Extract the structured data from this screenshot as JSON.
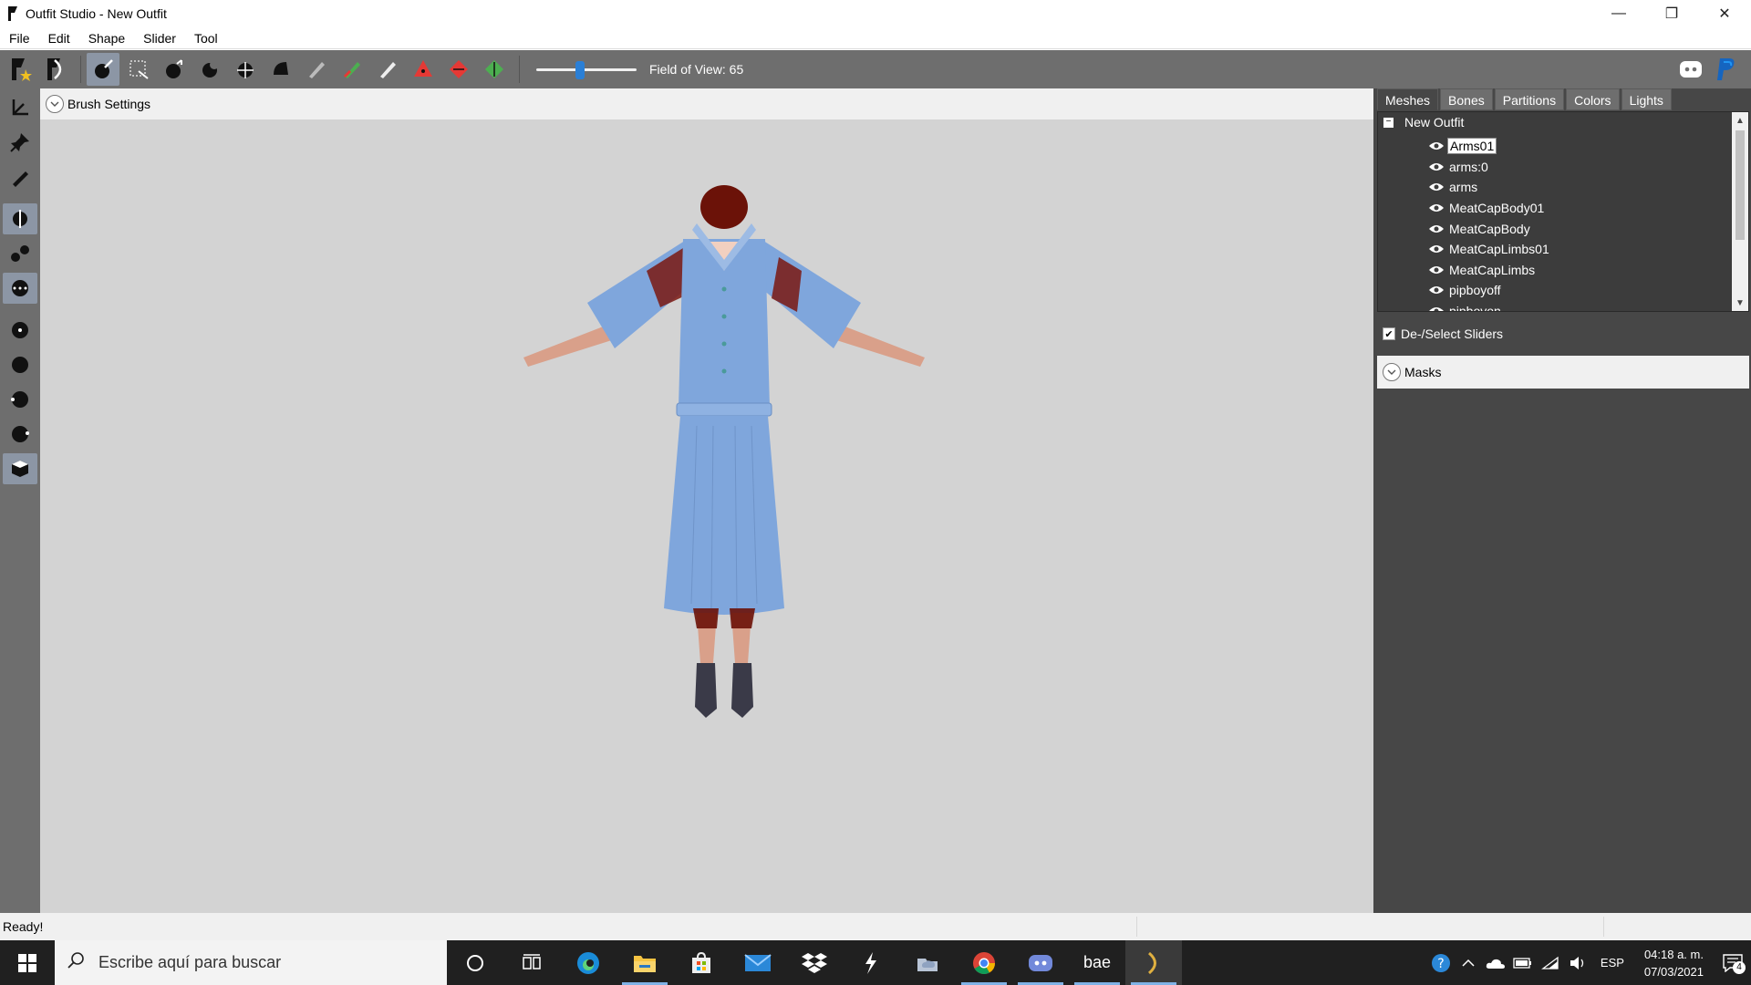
{
  "window": {
    "title": "Outfit Studio - New Outfit",
    "minimize": "—",
    "restore": "❐",
    "close": "✕"
  },
  "menu": [
    "File",
    "Edit",
    "Shape",
    "Slider",
    "Tool"
  ],
  "toolbar": {
    "fov_label": "Field of View: 65",
    "fov_value": 65
  },
  "viewport": {
    "brush_settings": "Brush Settings"
  },
  "right_panel": {
    "tabs": [
      "Meshes",
      "Bones",
      "Partitions",
      "Colors",
      "Lights"
    ],
    "active_tab": "Meshes",
    "tree_root": "New Outfit",
    "meshes": [
      "Arms01",
      "arms:0",
      "arms",
      "MeatCapBody01",
      "MeatCapBody",
      "MeatCapLimbs01",
      "MeatCapLimbs",
      "pipboyoff",
      "pipboyon"
    ],
    "selected_mesh": "Arms01",
    "deselect_sliders": "De-/Select Sliders",
    "masks": "Masks"
  },
  "status": {
    "text": "Ready!"
  },
  "taskbar": {
    "search_placeholder": "Escribe aquí para buscar",
    "app_bae_label": "bae",
    "language": "ESP",
    "time": "04:18 a. m.",
    "date": "07/03/2021",
    "notification_count": "4"
  },
  "colors": {
    "toolbar_bg": "#6e6e6e",
    "viewport_bg": "#d3d3d3",
    "panel_bg": "#474747",
    "accent": "#2a7fd6",
    "dress": "#7fa6dc"
  }
}
